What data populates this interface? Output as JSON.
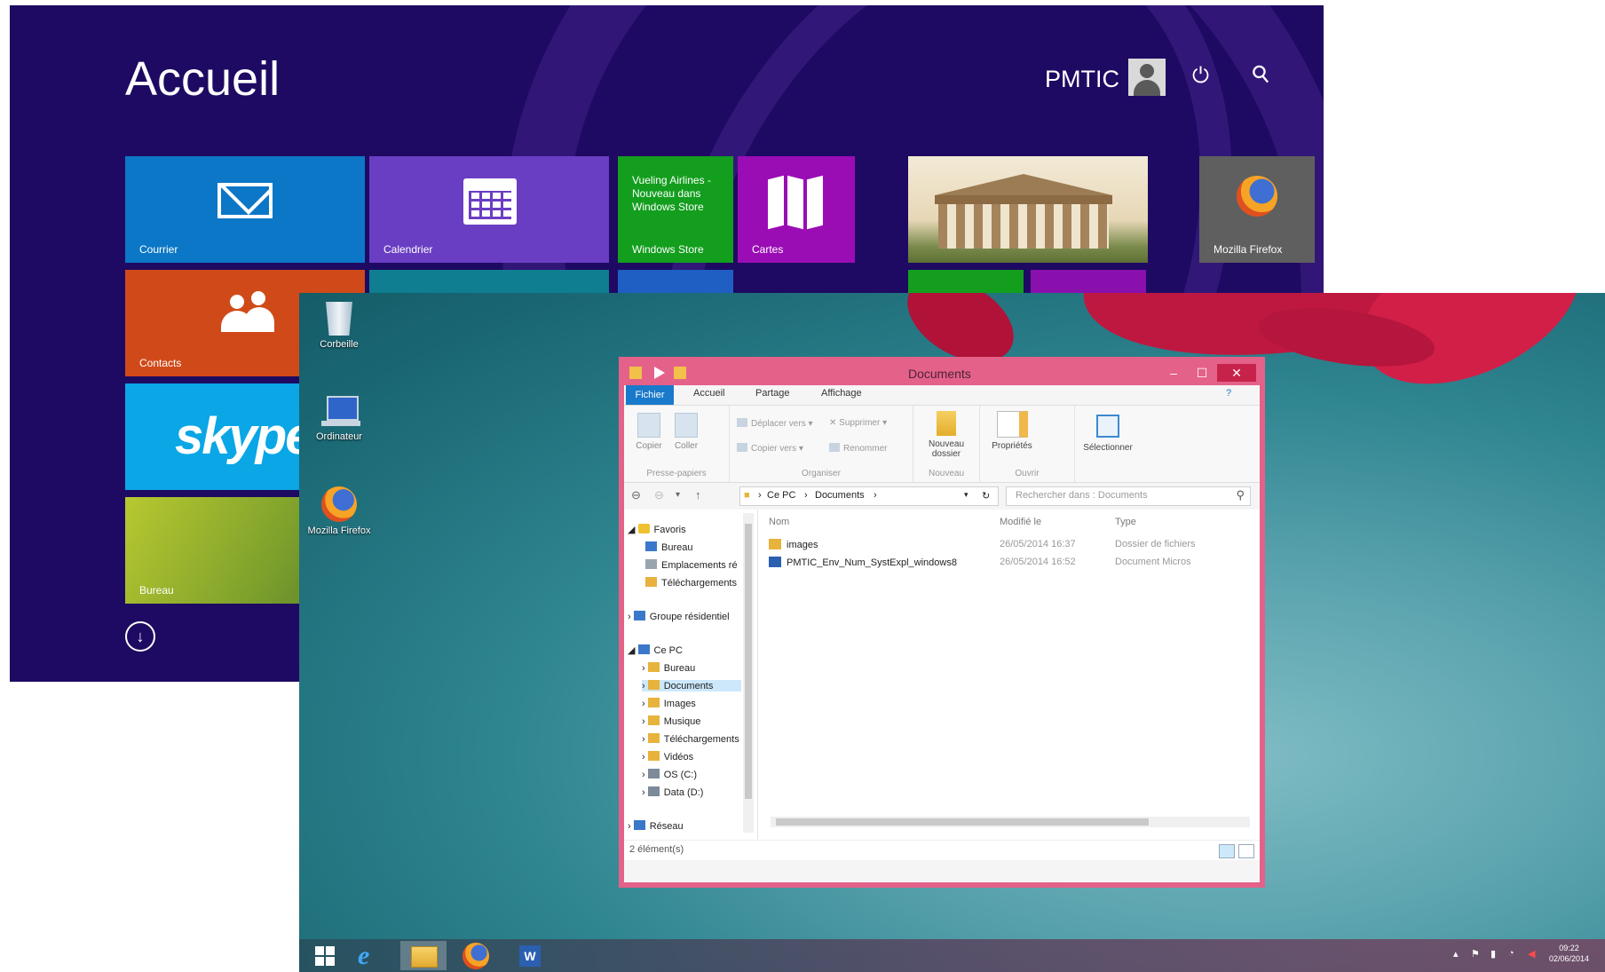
{
  "start_screen": {
    "title": "Accueil",
    "user_name": "PMTIC",
    "tiles": {
      "mail": "Courrier",
      "calendar": "Calendrier",
      "store_news": "Vueling Airlines - Nouveau dans Windows Store",
      "store": "Windows Store",
      "maps": "Cartes",
      "firefox": "Mozilla Firefox",
      "contacts": "Contacts",
      "skype": "skype",
      "desktop": "Bureau"
    }
  },
  "desktop": {
    "icons": [
      {
        "label": "Corbeille",
        "icon": "recycle-bin-icon"
      },
      {
        "label": "Ordinateur",
        "icon": "computer-icon"
      },
      {
        "label": "Mozilla Firefox",
        "icon": "firefox-icon"
      }
    ]
  },
  "explorer": {
    "title": "Documents",
    "tabs": {
      "file": "Fichier",
      "home": "Accueil",
      "share": "Partage",
      "view": "Affichage"
    },
    "ribbon": {
      "copy": "Copier",
      "paste": "Coller",
      "clipboard_group": "Presse-papiers",
      "move_to": "Déplacer vers",
      "copy_to": "Copier vers",
      "delete": "Supprimer",
      "rename": "Renommer",
      "organize_group": "Organiser",
      "new_folder": "Nouveau dossier",
      "new_group": "Nouveau",
      "properties": "Propriétés",
      "open_group": "Ouvrir",
      "select": "Sélectionner"
    },
    "address": {
      "crumb1": "Ce PC",
      "crumb2": "Documents"
    },
    "search_placeholder": "Rechercher dans : Documents",
    "nav": {
      "favorites": "Favoris",
      "desktop": "Bureau",
      "recent": "Emplacements ré",
      "downloads": "Téléchargements",
      "homegroup": "Groupe résidentiel",
      "this_pc": "Ce PC",
      "pc_desktop": "Bureau",
      "documents": "Documents",
      "images": "Images",
      "music": "Musique",
      "pc_downloads": "Téléchargements",
      "videos": "Vidéos",
      "os": "OS (C:)",
      "data": "Data (D:)",
      "network": "Réseau"
    },
    "columns": {
      "name": "Nom",
      "modified": "Modifié le",
      "type": "Type"
    },
    "files": [
      {
        "name": "images",
        "modified": "26/05/2014 16:37",
        "type": "Dossier de fichiers"
      },
      {
        "name": "PMTIC_Env_Num_SystExpl_windows8",
        "modified": "26/05/2014 16:52",
        "type": "Document Micros"
      }
    ],
    "status": "2 élément(s)"
  },
  "taskbar": {
    "time": "09:22",
    "date": "02/06/2014"
  },
  "colors": {
    "start_bg": "#1e0a62",
    "window_border": "#e4618a",
    "file_tab": "#1979ca"
  }
}
